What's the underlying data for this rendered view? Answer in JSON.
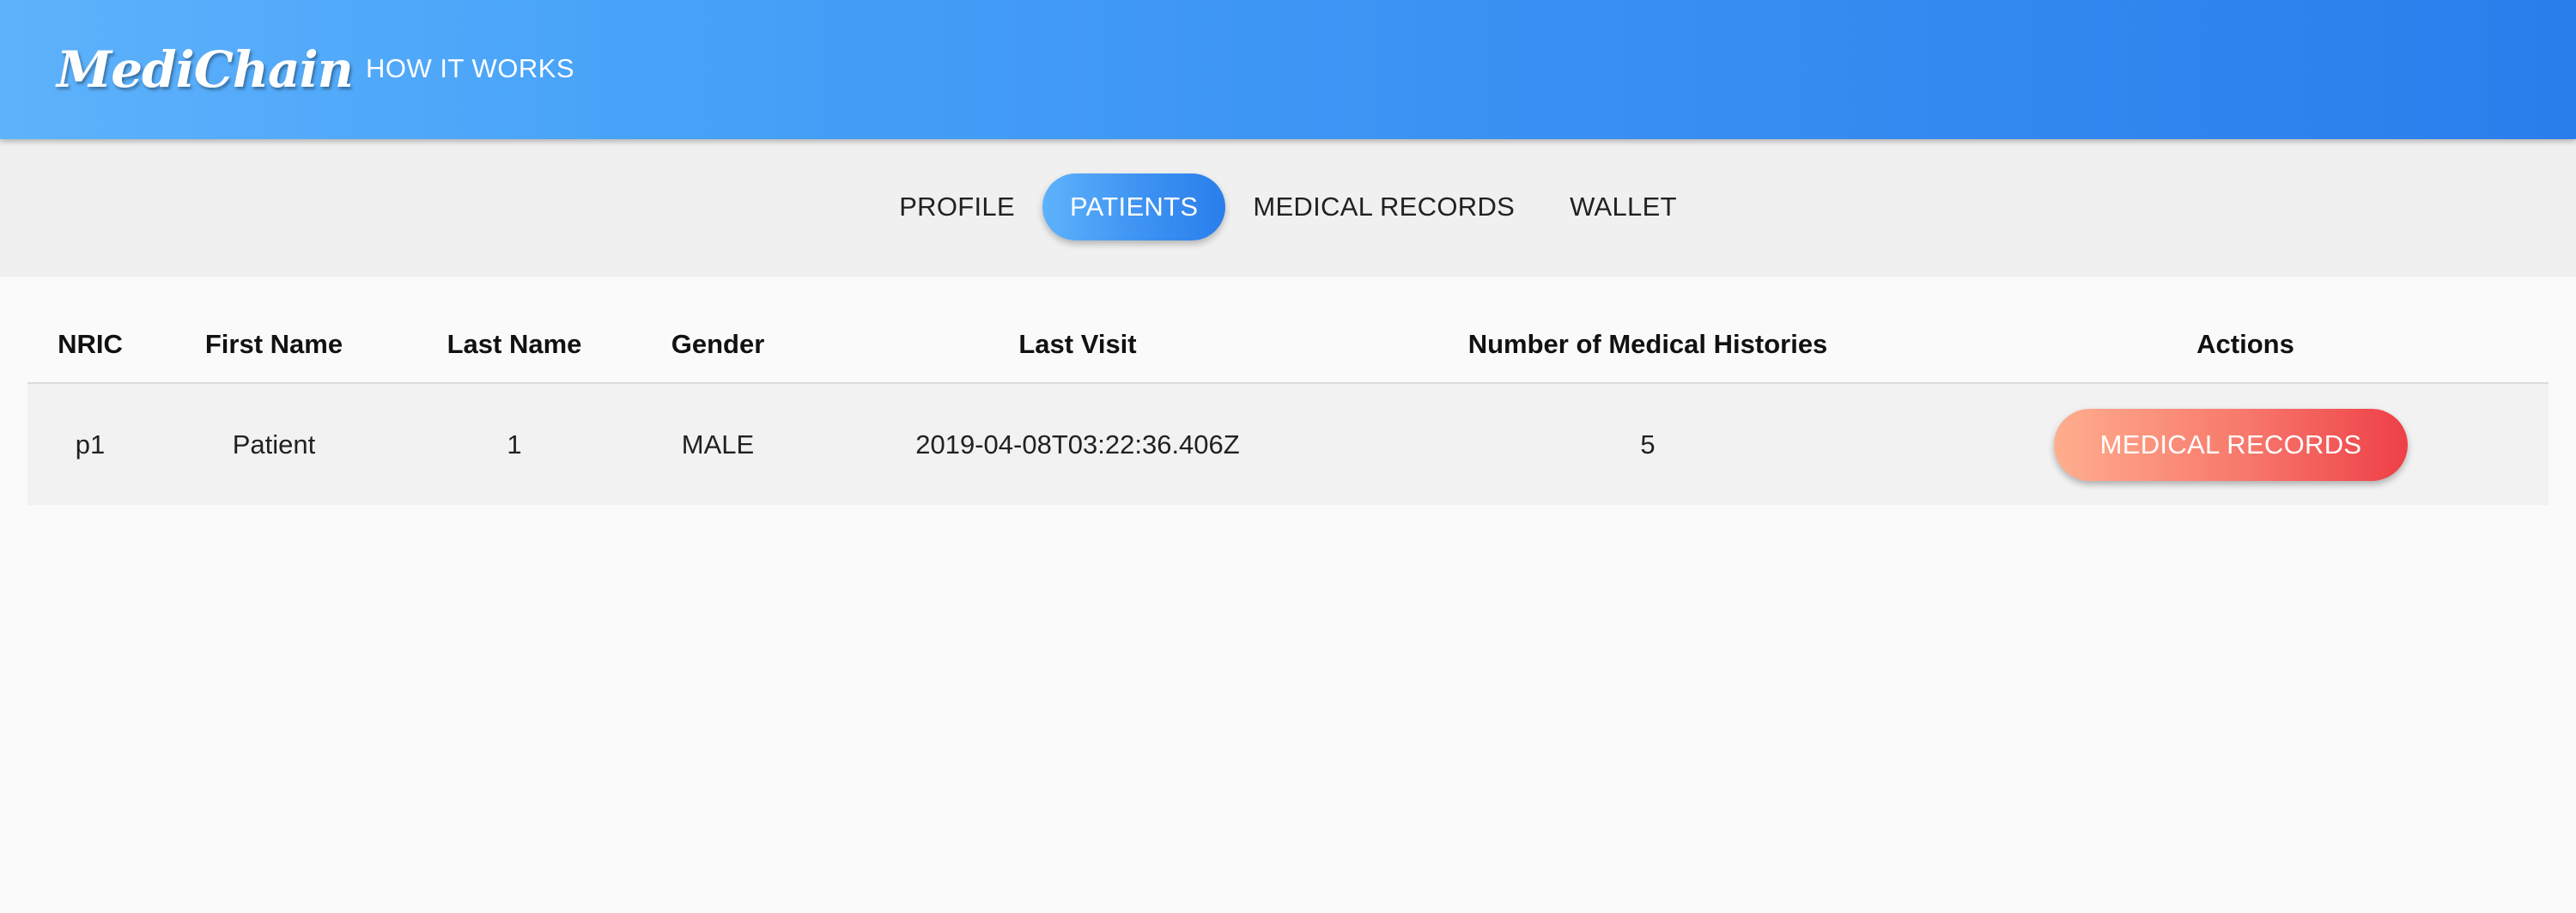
{
  "navbar": {
    "brand": "MediChain",
    "links": [
      "HOW IT WORKS"
    ]
  },
  "tabs": [
    {
      "label": "PROFILE",
      "active": false
    },
    {
      "label": "PATIENTS",
      "active": true
    },
    {
      "label": "MEDICAL RECORDS",
      "active": false
    },
    {
      "label": "WALLET",
      "active": false
    }
  ],
  "table": {
    "headers": [
      "NRIC",
      "First Name",
      "Last Name",
      "Gender",
      "Last Visit",
      "Number of Medical Histories",
      "Actions"
    ],
    "rows": [
      {
        "nric": "p1",
        "first_name": "Patient",
        "last_name": "1",
        "gender": "MALE",
        "last_visit": "2019-04-08T03:22:36.406Z",
        "medical_histories": "5",
        "action_label": "MEDICAL RECORDS"
      }
    ]
  },
  "colors": {
    "primary_gradient_start": "#5eb2fb",
    "primary_gradient_end": "#2a7eec",
    "action_gradient_start": "#ffae8e",
    "action_gradient_end": "#ee3f47"
  }
}
